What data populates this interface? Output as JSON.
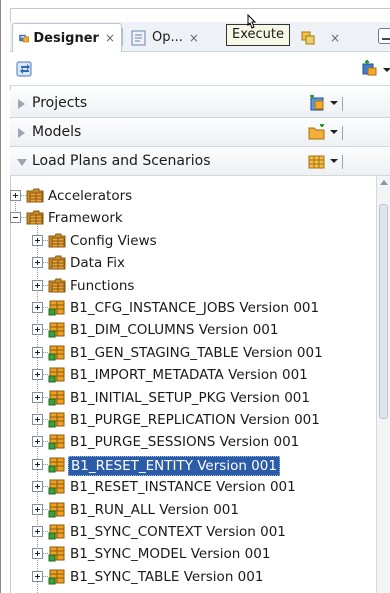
{
  "tabs": [
    {
      "label": "Designer",
      "close": "×",
      "icon": "designer-navigator-icon"
    },
    {
      "label": "Op...",
      "close": "×",
      "icon": "operator-navigator-icon"
    },
    {
      "label": "",
      "close": "×",
      "icon": "topology-navigator-icon"
    }
  ],
  "tooltip": "Execute",
  "toolbar": {
    "left_icon": "connect-repository-icon",
    "right_icon": "add-toolbar-icon"
  },
  "sections": [
    {
      "label": "Projects",
      "expanded": false,
      "icon": "new-project-icon"
    },
    {
      "label": "Models",
      "expanded": false,
      "icon": "new-model-folder-icon"
    },
    {
      "label": "Load Plans and Scenarios",
      "expanded": true,
      "icon": "new-load-plan-icon"
    }
  ],
  "tree": {
    "nodes": [
      {
        "label": "Accelerators",
        "level": 0,
        "expander": "plus",
        "icon": "folder-icon"
      },
      {
        "label": "Framework",
        "level": 0,
        "expander": "minus",
        "icon": "folder-icon"
      },
      {
        "label": "Config Views",
        "level": 1,
        "expander": "plus",
        "icon": "folder-icon"
      },
      {
        "label": "Data Fix",
        "level": 1,
        "expander": "plus",
        "icon": "folder-icon"
      },
      {
        "label": "Functions",
        "level": 1,
        "expander": "plus",
        "icon": "folder-icon"
      },
      {
        "label": "B1_CFG_INSTANCE_JOBS Version 001",
        "level": 1,
        "expander": "plus",
        "icon": "scenario-icon"
      },
      {
        "label": "B1_DIM_COLUMNS Version 001",
        "level": 1,
        "expander": "plus",
        "icon": "scenario-icon"
      },
      {
        "label": "B1_GEN_STAGING_TABLE Version 001",
        "level": 1,
        "expander": "plus",
        "icon": "scenario-icon"
      },
      {
        "label": "B1_IMPORT_METADATA Version 001",
        "level": 1,
        "expander": "plus",
        "icon": "scenario-icon"
      },
      {
        "label": "B1_INITIAL_SETUP_PKG Version 001",
        "level": 1,
        "expander": "plus",
        "icon": "scenario-icon"
      },
      {
        "label": "B1_PURGE_REPLICATION Version 001",
        "level": 1,
        "expander": "plus",
        "icon": "scenario-icon"
      },
      {
        "label": "B1_PURGE_SESSIONS Version 001",
        "level": 1,
        "expander": "plus",
        "icon": "scenario-icon"
      },
      {
        "label": "B1_RESET_ENTITY Version 001",
        "level": 1,
        "expander": "plus",
        "icon": "scenario-icon",
        "selected": true
      },
      {
        "label": "B1_RESET_INSTANCE Version 001",
        "level": 1,
        "expander": "plus",
        "icon": "scenario-icon"
      },
      {
        "label": "B1_RUN_ALL Version 001",
        "level": 1,
        "expander": "plus",
        "icon": "scenario-icon"
      },
      {
        "label": "B1_SYNC_CONTEXT Version 001",
        "level": 1,
        "expander": "plus",
        "icon": "scenario-icon"
      },
      {
        "label": "B1_SYNC_MODEL Version 001",
        "level": 1,
        "expander": "plus",
        "icon": "scenario-icon"
      },
      {
        "label": "B1_SYNC_TABLE Version 001",
        "level": 1,
        "expander": "plus",
        "icon": "scenario-icon"
      }
    ]
  },
  "colors": {
    "selection": "#2c5ba8",
    "folder": "#e8a33a",
    "scenario_orange": "#f0a020",
    "scenario_green": "#3aa040"
  }
}
